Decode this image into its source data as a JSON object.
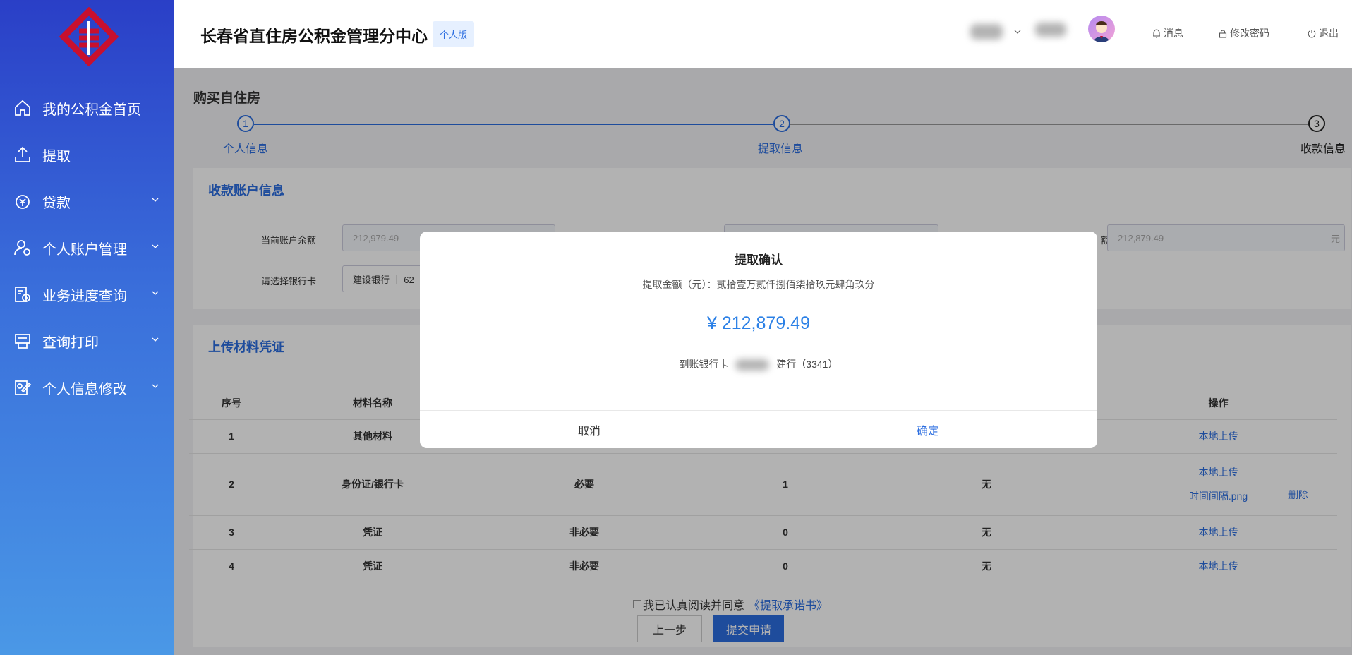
{
  "sidebar": {
    "items": [
      {
        "label": "我的公积金首页",
        "icon": "home-icon",
        "has_children": false
      },
      {
        "label": "提取",
        "icon": "upload-icon",
        "has_children": false
      },
      {
        "label": "贷款",
        "icon": "money-bag-icon",
        "has_children": true
      },
      {
        "label": "个人账户管理",
        "icon": "user-settings-icon",
        "has_children": true
      },
      {
        "label": "业务进度查询",
        "icon": "progress-query-icon",
        "has_children": true
      },
      {
        "label": "查询打印",
        "icon": "printer-icon",
        "has_children": true
      },
      {
        "label": "个人信息修改",
        "icon": "edit-profile-icon",
        "has_children": true
      }
    ]
  },
  "header": {
    "title": "长春省直住房公积金管理分中心",
    "badge": "个人版",
    "messages": "消息",
    "change_password": "修改密码",
    "logout": "退出"
  },
  "main": {
    "page_title": "购买自住房",
    "steps": [
      {
        "num": "1",
        "label": "个人信息",
        "state": "done"
      },
      {
        "num": "2",
        "label": "提取信息",
        "state": "done"
      },
      {
        "num": "3",
        "label": "收款信息",
        "state": "current"
      }
    ],
    "account": {
      "title": "收款账户信息",
      "balance_label": "当前账户余额",
      "balance_value": "212,979.49",
      "amount_label_tail": "额",
      "amount_value": "212,879.49",
      "amount_unit": "元",
      "bank_label": "请选择银行卡",
      "bank_value": "建设银行 ｜ 62"
    },
    "materials": {
      "title": "上传材料凭证",
      "headers": [
        "序号",
        "材料名称",
        "",
        "",
        "",
        "操作"
      ],
      "rows": [
        {
          "no": "1",
          "name": "其他材料",
          "required": "",
          "count": "",
          "note": "",
          "action": "本地上传",
          "file": "",
          "delete": ""
        },
        {
          "no": "2",
          "name": "身份证/银行卡",
          "required": "必要",
          "count": "1",
          "note": "无",
          "action": "本地上传",
          "file": "时间间隔.png",
          "delete": "删除"
        },
        {
          "no": "3",
          "name": "凭证",
          "required": "非必要",
          "count": "0",
          "note": "无",
          "action": "本地上传",
          "file": "",
          "delete": ""
        },
        {
          "no": "4",
          "name": "凭证",
          "required": "非必要",
          "count": "0",
          "note": "无",
          "action": "本地上传",
          "file": "",
          "delete": ""
        }
      ]
    },
    "agree_prefix": "我已认真阅读并同意",
    "agree_link": "《提取承诺书》",
    "prev_button": "上一步",
    "submit_button": "提交申请"
  },
  "modal": {
    "title": "提取确认",
    "amount_text": "提取金额（元）：贰拾壹万贰仟捌佰柒拾玖元肆角玖分",
    "amount": "¥ 212,879.49",
    "bank_prefix": "到账银行卡",
    "bank_suffix": "建行（3341）",
    "cancel": "取消",
    "confirm": "确定"
  },
  "colors": {
    "primary": "#2b6de0",
    "sidebar_top": "#2a3fc7",
    "sidebar_bottom": "#4a98e6",
    "logo_red": "#c8102e"
  }
}
